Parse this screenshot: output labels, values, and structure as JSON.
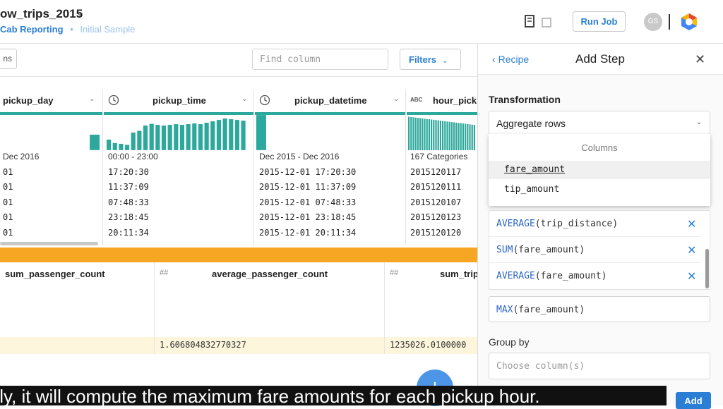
{
  "header": {
    "dataset_title": "ow_trips_2015",
    "breadcrumb_flow": "Cab Reporting",
    "breadcrumb_separator": "•",
    "breadcrumb_sample": "Initial Sample",
    "run_job_label": "Run Job",
    "avatar_initials": "GS"
  },
  "toolbar": {
    "columns_label": "ns",
    "find_column_placeholder": "Find column",
    "filters_label": "Filters"
  },
  "grid": {
    "columns": [
      {
        "name": "pickup_day",
        "range": "Dec 2016",
        "values": [
          "01",
          "01",
          "01",
          "01",
          "01"
        ]
      },
      {
        "name": "pickup_time",
        "range": "00:00 - 23:00",
        "values": [
          "17:20:30",
          "11:37:09",
          "07:48:33",
          "23:18:45",
          "20:11:34"
        ]
      },
      {
        "name": "pickup_datetime",
        "range": "Dec 2015 - Dec 2016",
        "values": [
          "2015-12-01 17:20:30",
          "2015-12-01 11:37:09",
          "2015-12-01 07:48:33",
          "2015-12-01 23:18:45",
          "2015-12-01 20:11:34"
        ]
      },
      {
        "name": "hour_pick",
        "type_label": "ABC",
        "range": "167 Categories",
        "values": [
          "2015120117",
          "2015120111",
          "2015120107",
          "2015120123",
          "2015120120"
        ]
      }
    ]
  },
  "aggregate_preview": {
    "columns": [
      {
        "name": "sum_passenger_count",
        "value": ""
      },
      {
        "name": "average_passenger_count",
        "type_label": "##",
        "value": "1.606804832770327"
      },
      {
        "name": "sum_trip",
        "type_label": "##",
        "value": "1235026.0100000"
      }
    ]
  },
  "panel": {
    "recipe_label": "Recipe",
    "title": "Add Step",
    "transformation_label": "Transformation",
    "transformation_value": "Aggregate rows",
    "dropdown": {
      "header": "Columns",
      "items": [
        "fare_amount",
        "tip_amount"
      ]
    },
    "functions": [
      {
        "fn": "AVERAGE",
        "arg": "(trip_distance)"
      },
      {
        "fn": "SUM",
        "arg": "(fare_amount)"
      },
      {
        "fn": "AVERAGE",
        "arg": "(fare_amount)"
      }
    ],
    "function_input": {
      "fn": "MAX",
      "arg": "(fare_amount)"
    },
    "group_by_label": "Group by",
    "group_by_placeholder": "Choose column(s)",
    "add_label": "Add"
  },
  "caption": "tly, it will compute the maximum fare amounts for each pickup hour.",
  "colors": {
    "accent": "#2a7fd4",
    "teal": "#2da89c",
    "orange": "#f6a623"
  }
}
